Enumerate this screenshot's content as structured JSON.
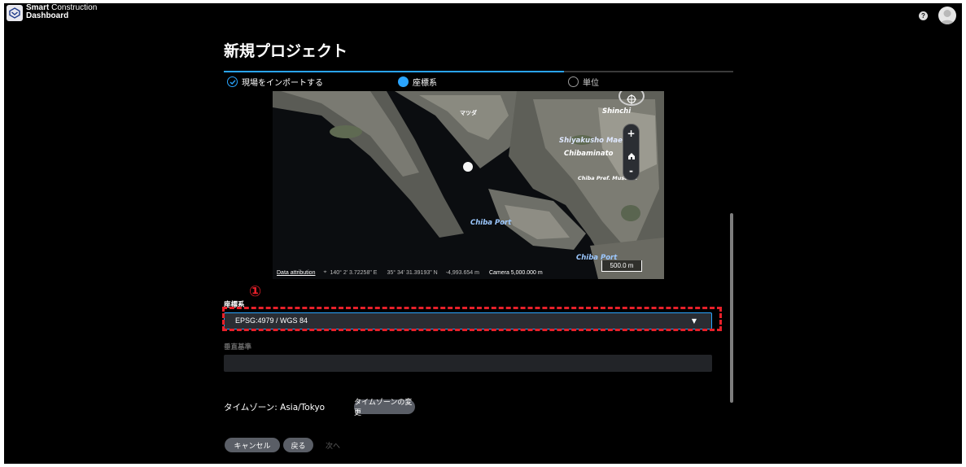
{
  "app": {
    "name_bold": "Smart",
    "name_rest": "Construction",
    "name_line2": "Dashboard"
  },
  "page": {
    "title": "新規プロジェクト"
  },
  "steps": [
    {
      "label": "現場をインポートする",
      "state": "done"
    },
    {
      "label": "座標系",
      "state": "active"
    },
    {
      "label": "単位",
      "state": "pending"
    }
  ],
  "map": {
    "labels": {
      "chiba_port": "Chiba Port",
      "chiba_port2": "Chiba Port",
      "shiyakusho": "Shiyakusho Mae",
      "chibaminato": "Chibaminato",
      "shinchi": "Shinchi",
      "chiba_pref": "Chiba Pref. Museum",
      "kanji1": "マツダ"
    },
    "controls": {
      "zoom_in": "+",
      "zoom_out": "-"
    },
    "footer": {
      "attribution": "Data attribution",
      "longitude": "140° 2' 3.72258\" E",
      "latitude": "35° 34' 31.39193\" N",
      "height": "-4,993.654 m",
      "camera": "Camera 5,000.000 m",
      "scale": "500.0 m"
    }
  },
  "form": {
    "coordinate_label": "座標系",
    "coordinate_value": "EPSG:4979 / WGS 84",
    "vertical_label": "垂直基準",
    "timezone_text": "タイムゾーン: Asia/Tokyo",
    "timezone_button": "タイムゾーンの変更"
  },
  "annotation": {
    "marker": "①",
    "color": "#e8202a"
  },
  "actions": {
    "cancel": "キャンセル",
    "back": "戻る",
    "next": "次へ"
  },
  "colors": {
    "accent": "#2aa5ff",
    "background": "#000000",
    "pill": "#5a5e66"
  }
}
